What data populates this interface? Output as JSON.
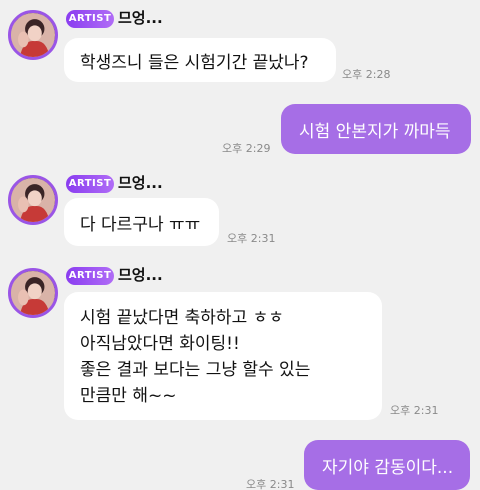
{
  "messages": [
    {
      "sender": "artist",
      "badge": "ARTIST",
      "name": "므엉...",
      "lines": [
        "학생즈니 들은 시험기간 끝났나?"
      ],
      "time": "오후 2:28"
    },
    {
      "sender": "me",
      "lines": [
        "시험 안본지가 까마득"
      ],
      "time": "오후 2:29"
    },
    {
      "sender": "artist",
      "badge": "ARTIST",
      "name": "므엉...",
      "lines": [
        "다 다르구나 ㅠㅠ"
      ],
      "time": "오후 2:31"
    },
    {
      "sender": "artist",
      "badge": "ARTIST",
      "name": "므엉...",
      "lines": [
        "시험 끝났다면 축하하고 ㅎㅎ",
        "아직남았다면 화이팅!!",
        "좋은 결과 보다는 그냥 할수 있는",
        "만큼만 해~~"
      ],
      "time": "오후 2:31"
    },
    {
      "sender": "me",
      "lines": [
        "자기야 감동이다..."
      ],
      "time": "오후 2:31"
    }
  ],
  "colors": {
    "accent": "#a66ee6",
    "badge": "#8a3df0",
    "background": "#f0f0f0",
    "bubble_incoming": "#ffffff"
  },
  "icons": {
    "avatar": "artist-profile-photo"
  }
}
